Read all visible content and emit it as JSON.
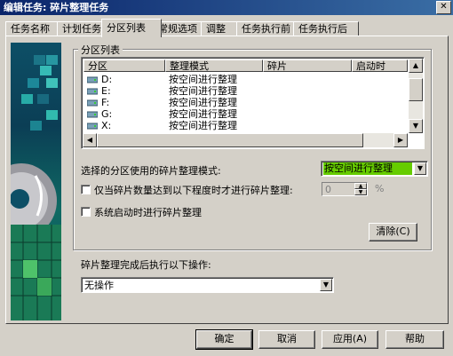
{
  "title": "编辑任务: 碎片整理任务",
  "close_glyph": "✕",
  "tabs": [
    {
      "label": "任务名称"
    },
    {
      "label": "计划任务"
    },
    {
      "label": "分区列表"
    },
    {
      "label": "常规选项"
    },
    {
      "label": "调整"
    },
    {
      "label": "任务执行前"
    },
    {
      "label": "任务执行后"
    }
  ],
  "active_tab": "分区列表",
  "partition_group": {
    "title": "分区列表",
    "columns": [
      "分区",
      "整理模式",
      "碎片",
      "启动时"
    ],
    "rows": [
      {
        "drive": "D:",
        "mode": "按空间进行整理"
      },
      {
        "drive": "E:",
        "mode": "按空间进行整理"
      },
      {
        "drive": "F:",
        "mode": "按空间进行整理"
      },
      {
        "drive": "G:",
        "mode": "按空间进行整理"
      },
      {
        "drive": "X:",
        "mode": "按空间进行整理"
      }
    ],
    "mode_label": "选择的分区使用的碎片整理模式:",
    "mode_selected": "按空间进行整理",
    "threshold_label": "仅当碎片数量达到以下程度时才进行碎片整理:",
    "threshold_value": "0",
    "threshold_unit": "%",
    "startup_label": "系统启动时进行碎片整理",
    "clear_button": "清除(C)"
  },
  "after_label": "碎片整理完成后执行以下操作:",
  "after_selected": "无操作",
  "buttons": {
    "ok": "确定",
    "cancel": "取消",
    "apply": "应用(A)",
    "help": "帮助"
  },
  "colors": {
    "mode_highlight": "#66cc00",
    "title_start": "#0a246a",
    "title_end": "#3a6ea5"
  }
}
